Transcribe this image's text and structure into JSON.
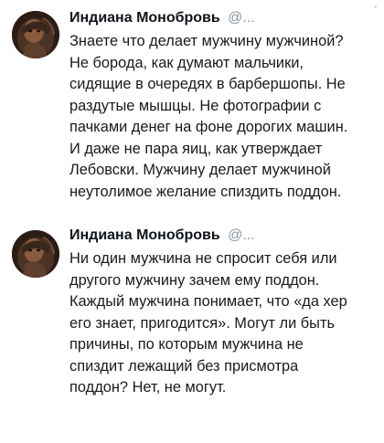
{
  "tweets": [
    {
      "author": {
        "name": "Индиана Монобровь",
        "handle": "@..."
      },
      "lines": [
        "Знаете что делает мужчину мужчиной?",
        "Не борода, как думают мальчики,",
        "сидящие в очередях в барбершопы. Не",
        "раздутые мышцы. Не фотографии с",
        "пачками денег на фоне дорогих машин.",
        "И даже не пара яиц, как утверждает",
        "Лебовски. Мужчину делает мужчиной",
        "неутолимое желание спиздить поддон."
      ]
    },
    {
      "author": {
        "name": "Индиана Монобровь",
        "handle": "@..."
      },
      "lines": [
        "Ни один мужчина не спросит себя или",
        "другого мужчину зачем ему поддон.",
        "Каждый мужчина понимает, что «да хер",
        "его знает, пригодится». Могут ли быть",
        "причины, по которым мужчина не",
        "спиздит лежащий без присмотра",
        "поддон? Нет, не могут."
      ]
    }
  ]
}
